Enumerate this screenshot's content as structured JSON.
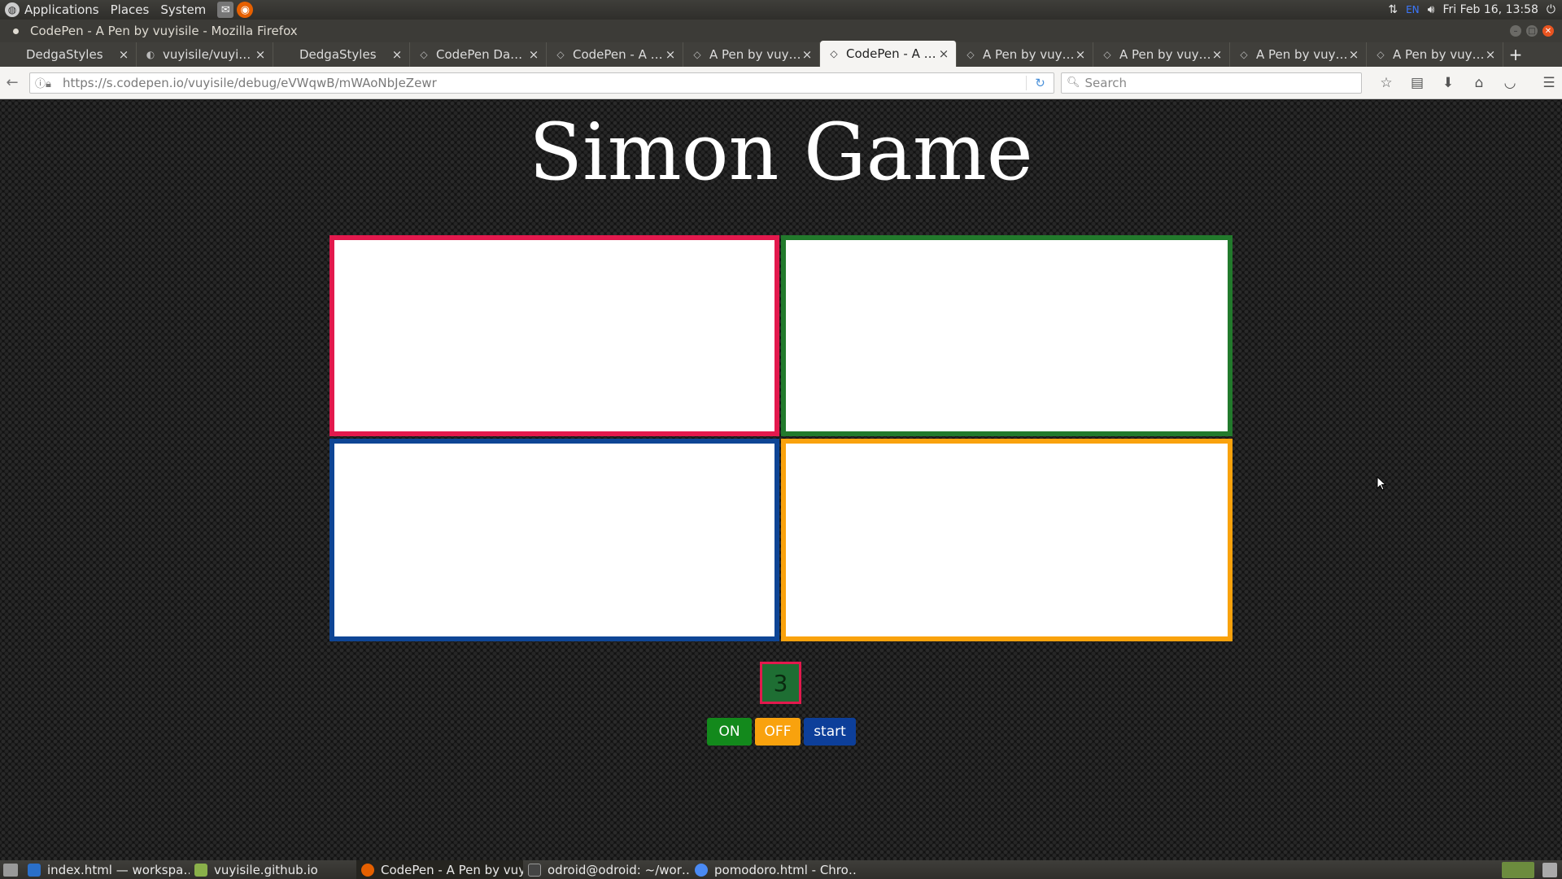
{
  "os_panel": {
    "menus": [
      "Applications",
      "Places",
      "System"
    ],
    "datetime": "Fri Feb 16, 13:58",
    "keyboard_layout": "EN"
  },
  "window": {
    "title": "CodePen - A Pen by vuyisile - Mozilla Firefox"
  },
  "tabs": [
    {
      "label": "DedgaStyles",
      "icon": "blank-page-icon",
      "active": false
    },
    {
      "label": "vuyisile/vuyis…",
      "icon": "github-icon",
      "active": false
    },
    {
      "label": "DedgaStyles",
      "icon": "blank-page-icon",
      "active": false
    },
    {
      "label": "CodePen Das…",
      "icon": "codepen-icon",
      "active": false
    },
    {
      "label": "CodePen - A P…",
      "icon": "codepen-icon",
      "active": false
    },
    {
      "label": "A Pen by vuyi…",
      "icon": "codepen-icon",
      "active": false
    },
    {
      "label": "CodePen - A P…",
      "icon": "codepen-icon",
      "active": true
    },
    {
      "label": "A Pen by vuyi…",
      "icon": "codepen-icon",
      "active": false
    },
    {
      "label": "A Pen by vuyi…",
      "icon": "codepen-icon",
      "active": false
    },
    {
      "label": "A Pen by vuyi…",
      "icon": "codepen-icon",
      "active": false
    },
    {
      "label": "A Pen by vuyi…",
      "icon": "codepen-icon",
      "active": false
    }
  ],
  "navbar": {
    "url": "https://s.codepen.io/vuyisile/debug/eVWqwB/mWAoNbJeZewr",
    "search_placeholder": "Search"
  },
  "game": {
    "title": "Simon Game",
    "pads": [
      {
        "name": "red",
        "color": "#e3194d"
      },
      {
        "name": "green",
        "color": "#227a2c"
      },
      {
        "name": "blue",
        "color": "#0e4595"
      },
      {
        "name": "yellow",
        "color": "#f9a20d"
      }
    ],
    "counter": "3",
    "buttons": {
      "on": "ON",
      "off": "OFF",
      "start": "start"
    }
  },
  "taskbar": [
    {
      "label": "index.html — workspa…",
      "active": false
    },
    {
      "label": "vuyisile.github.io",
      "active": false
    },
    {
      "label": "CodePen - A Pen by vuy…",
      "active": true
    },
    {
      "label": "odroid@odroid: ~/wor…",
      "active": false
    },
    {
      "label": "pomodoro.html - Chro…",
      "active": false
    }
  ]
}
